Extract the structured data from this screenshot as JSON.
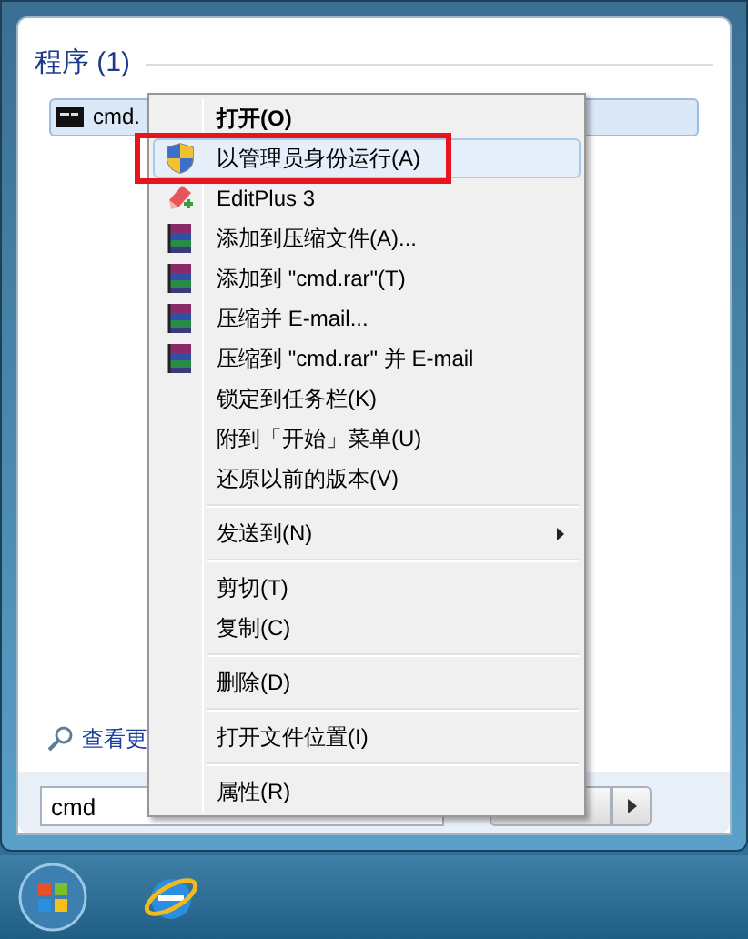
{
  "programs": {
    "heading": "程序 (1)",
    "items": [
      {
        "label": "cmd.",
        "selected": true
      }
    ]
  },
  "see_more": "查看更",
  "search": {
    "value": "cmd"
  },
  "context_menu": {
    "groups": [
      [
        {
          "label": "打开(O)",
          "bold": true,
          "kind": "plain",
          "selected": false
        },
        {
          "label": "以管理员身份运行(A)",
          "bold": false,
          "kind": "shield",
          "selected": true
        },
        {
          "label": "EditPlus 3",
          "bold": false,
          "kind": "editor",
          "selected": false
        },
        {
          "label": "添加到压缩文件(A)...",
          "bold": false,
          "kind": "archive",
          "selected": false
        },
        {
          "label": "添加到 \"cmd.rar\"(T)",
          "bold": false,
          "kind": "archive",
          "selected": false
        },
        {
          "label": "压缩并 E-mail...",
          "bold": false,
          "kind": "archive",
          "selected": false
        },
        {
          "label": "压缩到 \"cmd.rar\" 并 E-mail",
          "bold": false,
          "kind": "archive",
          "selected": false
        },
        {
          "label": "锁定到任务栏(K)",
          "bold": false,
          "kind": "plain",
          "selected": false
        },
        {
          "label": "附到「开始」菜单(U)",
          "bold": false,
          "kind": "plain",
          "selected": false
        },
        {
          "label": "还原以前的版本(V)",
          "bold": false,
          "kind": "plain",
          "selected": false
        }
      ],
      [
        {
          "label": "发送到(N)",
          "bold": false,
          "kind": "plain",
          "selected": false,
          "submenu": true
        }
      ],
      [
        {
          "label": "剪切(T)",
          "bold": false,
          "kind": "plain",
          "selected": false
        },
        {
          "label": "复制(C)",
          "bold": false,
          "kind": "plain",
          "selected": false
        }
      ],
      [
        {
          "label": "删除(D)",
          "bold": false,
          "kind": "plain",
          "selected": false
        }
      ],
      [
        {
          "label": "打开文件位置(I)",
          "bold": false,
          "kind": "plain",
          "selected": false
        }
      ],
      [
        {
          "label": "属性(R)",
          "bold": false,
          "kind": "plain",
          "selected": false
        }
      ]
    ]
  }
}
